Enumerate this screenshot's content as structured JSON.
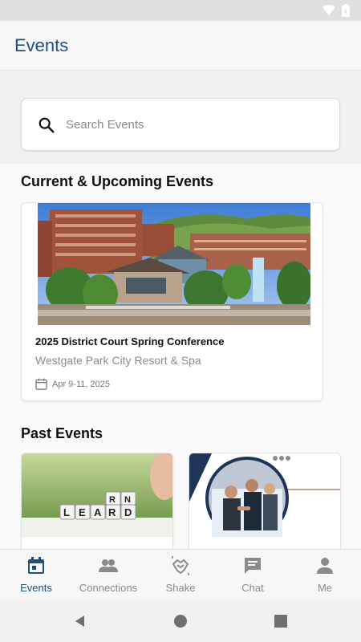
{
  "app_bar": {
    "title": "Events"
  },
  "search": {
    "placeholder": "Search Events"
  },
  "sections": {
    "current_title": "Current & Upcoming Events",
    "past_title": "Past Events"
  },
  "current_event": {
    "title": "2025 District Court Spring Conference",
    "venue": "Westgate Park City Resort & Spa",
    "date": "Apr 9-11, 2025"
  },
  "past_events": [
    {
      "image_icon": "lead-learn-blocks-photo",
      "image_text": "LEARN"
    },
    {
      "image_icon": "business-handshake-photo"
    }
  ],
  "bottom_nav": {
    "items": [
      {
        "label": "Events",
        "icon": "calendar-icon",
        "active": true
      },
      {
        "label": "Connections",
        "icon": "people-icon",
        "active": false
      },
      {
        "label": "Shake",
        "icon": "handshake-icon",
        "active": false
      },
      {
        "label": "Chat",
        "icon": "chat-icon",
        "active": false
      },
      {
        "label": "Me",
        "icon": "person-icon",
        "active": false
      }
    ]
  },
  "colors": {
    "brand": "#1f4e79",
    "muted": "#8a8a8a"
  }
}
